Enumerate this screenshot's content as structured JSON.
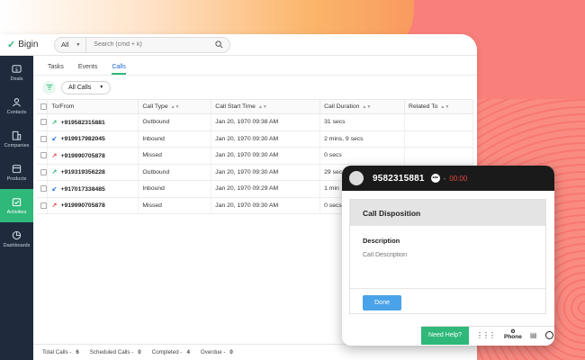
{
  "app": {
    "name": "Bigin"
  },
  "search": {
    "scope": "All",
    "placeholder": "Search (cmd + k)"
  },
  "sidebar": {
    "items": [
      {
        "label": "Deals",
        "icon": "dollar-icon",
        "active": false
      },
      {
        "label": "Contacts",
        "icon": "contacts-icon",
        "active": false
      },
      {
        "label": "Companies",
        "icon": "building-icon",
        "active": false
      },
      {
        "label": "Products",
        "icon": "box-icon",
        "active": false
      },
      {
        "label": "Activities",
        "icon": "calendar-check-icon",
        "active": true
      },
      {
        "label": "Dashboards",
        "icon": "pie-icon",
        "active": false
      }
    ]
  },
  "tabs": [
    "Tasks",
    "Events",
    "Calls"
  ],
  "active_tab": "Calls",
  "view_filter": "All Calls",
  "table": {
    "columns": [
      "To/From",
      "Call Type",
      "Call Start Time",
      "Call Duration",
      "Related To"
    ],
    "rows": [
      {
        "direction": "outbound",
        "number": "+919582315881",
        "type": "Outbound",
        "start": "Jan 20, 1970 09:38 AM",
        "duration": "31 secs"
      },
      {
        "direction": "inbound",
        "number": "+919917982045",
        "type": "Inbound",
        "start": "Jan 20, 1970 09:30 AM",
        "duration": "2 mins, 9 secs"
      },
      {
        "direction": "missed",
        "number": "+919990705878",
        "type": "Missed",
        "start": "Jan 20, 1970 09:30 AM",
        "duration": "0 secs"
      },
      {
        "direction": "outbound",
        "number": "+919319356228",
        "type": "Outbound",
        "start": "Jan 20, 1970 09:30 AM",
        "duration": "29 secs"
      },
      {
        "direction": "inbound",
        "number": "+917017338485",
        "type": "Inbound",
        "start": "Jan 20, 1970 09:29 AM",
        "duration": "1 min"
      },
      {
        "direction": "missed",
        "number": "+919990705878",
        "type": "Missed",
        "start": "Jan 20, 1970 09:30 AM",
        "duration": "0 secs"
      }
    ]
  },
  "footer": {
    "total_label": "Total Calls",
    "total_value": "6",
    "scheduled_label": "Scheduled Calls",
    "scheduled_value": "0",
    "completed_label": "Completed",
    "completed_value": "4",
    "overdue_label": "Overdue",
    "overdue_value": "0"
  },
  "dialer": {
    "number": "9582315881",
    "timer_sep": "-",
    "timer": "00:00",
    "disposition_title": "Call Disposition",
    "description_label": "Description",
    "description_placeholder": "Call Description",
    "done_label": "Done",
    "help_label": "Need Help?",
    "phone_label": "Phone"
  },
  "colors": {
    "accent": "#2eb879",
    "sidebar": "#1f2b3d",
    "link": "#1a6bd6",
    "missed": "#e0473f",
    "done_button": "#4aa3e8"
  }
}
